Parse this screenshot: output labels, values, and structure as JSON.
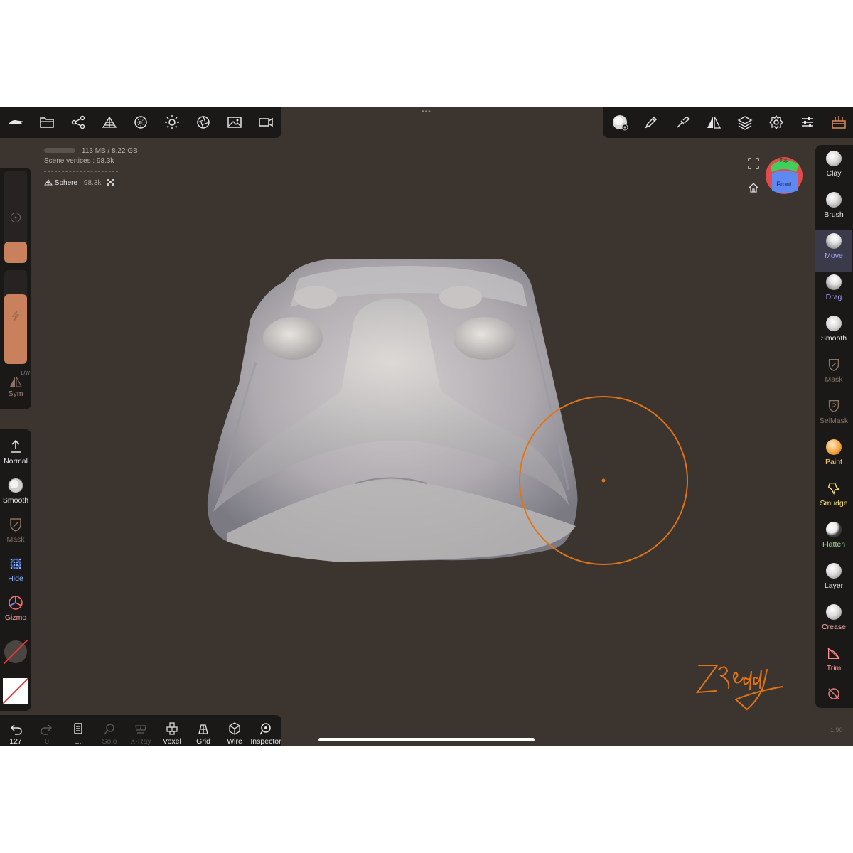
{
  "top_toolbar_left": [
    {
      "name": "menu-logo-icon"
    },
    {
      "name": "folder-icon"
    },
    {
      "name": "scene-tree-icon"
    },
    {
      "name": "topology-icon",
      "sub": "..."
    },
    {
      "name": "material-sphere-icon"
    },
    {
      "name": "light-sun-icon"
    },
    {
      "name": "camera-aperture-icon"
    },
    {
      "name": "image-icon"
    },
    {
      "name": "video-icon"
    }
  ],
  "top_handle": "•••",
  "top_toolbar_right": [
    {
      "name": "brush-material-icon"
    },
    {
      "name": "stroke-pen-icon",
      "sub": "..."
    },
    {
      "name": "picker-icon",
      "sub": "..."
    },
    {
      "name": "symmetry-icon"
    },
    {
      "name": "layers-icon"
    },
    {
      "name": "settings-gear-icon"
    },
    {
      "name": "sliders-icon",
      "sub": "..."
    },
    {
      "name": "toolbox-icon"
    }
  ],
  "info": {
    "memory": "113 MB / 8.22 GB",
    "vertices": "Scene vertices : 98.3k",
    "object_name": "Sphere",
    "object_detail": "· 98.3k ·"
  },
  "left_panel": {
    "sym_label": "Sym",
    "sym_sub": "L/W"
  },
  "left_tools": [
    {
      "label": "Normal",
      "name": "normal-mode",
      "color": "#e8e8e8"
    },
    {
      "label": "Smooth",
      "name": "smooth-tool",
      "color": "#e8e8e8"
    },
    {
      "label": "Mask",
      "name": "mask-tool",
      "color": "#8a7364"
    },
    {
      "label": "Hide",
      "name": "hide-tool",
      "color": "#8ab4ff"
    },
    {
      "label": "Gizmo",
      "name": "gizmo-tool",
      "color": "#ff9f9f"
    }
  ],
  "right_tools": [
    {
      "label": "Clay",
      "color": "#e8e8e8",
      "selected": false
    },
    {
      "label": "Brush",
      "color": "#e8e8e8",
      "selected": false
    },
    {
      "label": "Move",
      "color": "#a6a2ff",
      "selected": true
    },
    {
      "label": "Drag",
      "color": "#a6a2ff",
      "selected": false
    },
    {
      "label": "Smooth",
      "color": "#e8e8e8",
      "selected": false
    },
    {
      "label": "Mask",
      "color": "#8a7364",
      "selected": false
    },
    {
      "label": "SelMask",
      "color": "#8a7364",
      "selected": false
    },
    {
      "label": "Paint",
      "color": "#ffd37a",
      "selected": false
    },
    {
      "label": "Smudge",
      "color": "#f5e27a",
      "selected": false
    },
    {
      "label": "Flatten",
      "color": "#9fe08a",
      "selected": false
    },
    {
      "label": "Layer",
      "color": "#e8e8e8",
      "selected": false
    },
    {
      "label": "Crease",
      "color": "#ffb0b0",
      "selected": false
    },
    {
      "label": "Trim",
      "color": "#ff9f9f",
      "selected": false
    }
  ],
  "bottom_toolbar": [
    {
      "label": "127",
      "name": "undo-button",
      "dim": false
    },
    {
      "label": "0",
      "name": "redo-button",
      "dim": true
    },
    {
      "label": "...",
      "name": "history-button",
      "dim": false
    },
    {
      "label": "Solo",
      "name": "solo-button",
      "dim": true
    },
    {
      "label": "X-Ray",
      "name": "xray-button",
      "dim": true
    },
    {
      "label": "Voxel",
      "name": "voxel-button",
      "dim": false
    },
    {
      "label": "Grid",
      "name": "grid-button",
      "dim": false
    },
    {
      "label": "Wire",
      "name": "wire-button",
      "dim": false
    },
    {
      "label": "Inspector",
      "name": "inspector-button",
      "dim": false
    }
  ],
  "view_cube": {
    "top": "Top",
    "front": "Front"
  },
  "version": "1.90",
  "brush_color": "#e07418",
  "accent_color": "#c8815c"
}
